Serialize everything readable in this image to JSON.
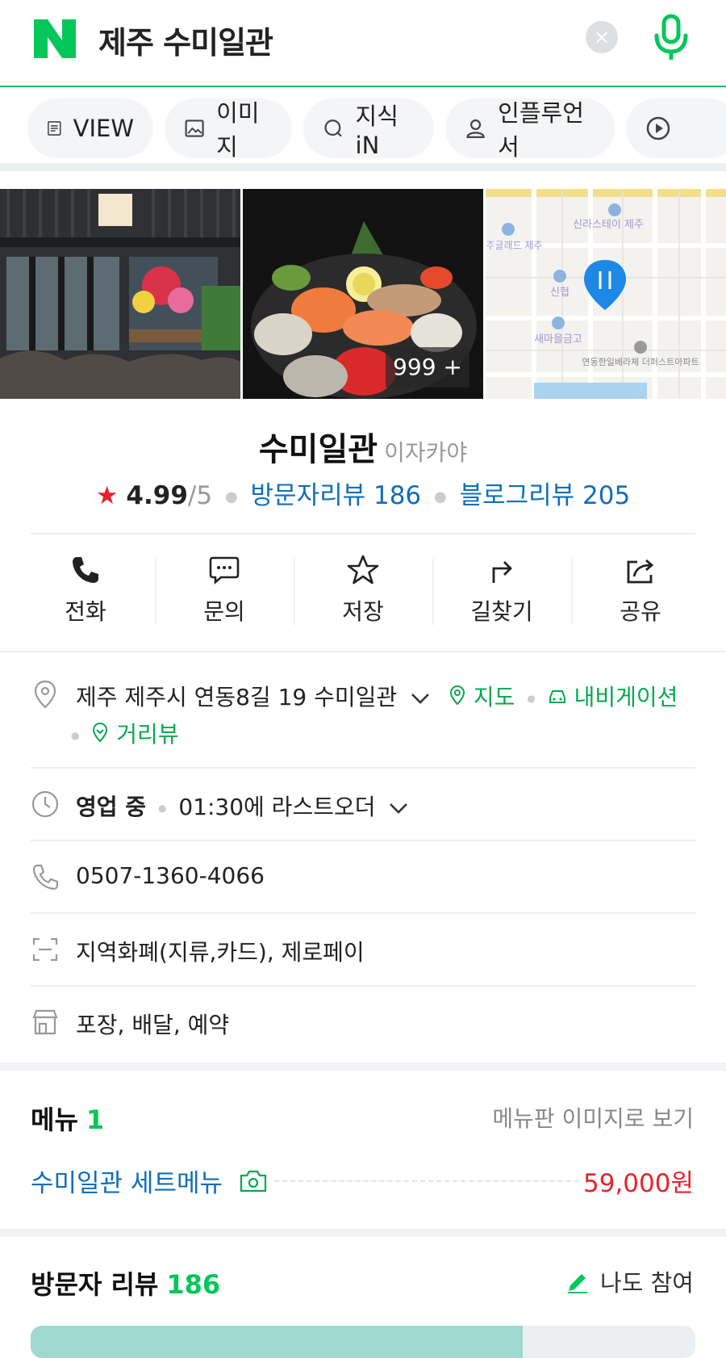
{
  "search": {
    "query": "제주 수미일관",
    "clear_glyph": "×"
  },
  "tabs": [
    {
      "label": "VIEW",
      "icon": "doc-icon"
    },
    {
      "label": "이미지",
      "icon": "image-icon"
    },
    {
      "label": "지식iN",
      "icon": "q-icon"
    },
    {
      "label": "인플루언서",
      "icon": "person-icon"
    },
    {
      "label": "",
      "icon": "play-icon"
    }
  ],
  "photos": {
    "count_label": "999 +",
    "map_labels": [
      "신라스테이 제주",
      "제주글래드 제주",
      "신협",
      "새마을금고",
      "연동한일베라체 더퍼스트아파트"
    ]
  },
  "place": {
    "name": "수미일관",
    "category": "이자카야",
    "rating": "4.99",
    "rating_max": "/5",
    "visitor_reviews": "방문자리뷰 186",
    "blog_reviews": "블로그리뷰 205"
  },
  "actions": [
    {
      "label": "전화",
      "icon": "phone-icon"
    },
    {
      "label": "문의",
      "icon": "chat-icon"
    },
    {
      "label": "저장",
      "icon": "star-icon"
    },
    {
      "label": "길찾기",
      "icon": "route-icon"
    },
    {
      "label": "공유",
      "icon": "share-icon"
    }
  ],
  "info": {
    "address": "제주 제주시 연동8길 19 수미일관",
    "map_link": "지도",
    "navi_link": "내비게이션",
    "street_link": "거리뷰",
    "status": "영업 중",
    "hours": "01:30에 라스트오더",
    "phone": "0507-1360-4066",
    "payment": "지역화폐(지류,카드), 제로페이",
    "services": "포장, 배달, 예약"
  },
  "menu": {
    "title": "메뉴",
    "count": "1",
    "view_link": "메뉴판 이미지로 보기",
    "items": [
      {
        "name": "수미일관 세트메뉴",
        "price": "59,000원"
      }
    ]
  },
  "reviews": {
    "title": "방문자 리뷰",
    "count": "186",
    "join_label": "나도 참여",
    "bar_fill": 0.74
  },
  "colors": {
    "naver_green": "#03c75a",
    "link_blue": "#0f6fba",
    "price_red": "#e5232e"
  }
}
